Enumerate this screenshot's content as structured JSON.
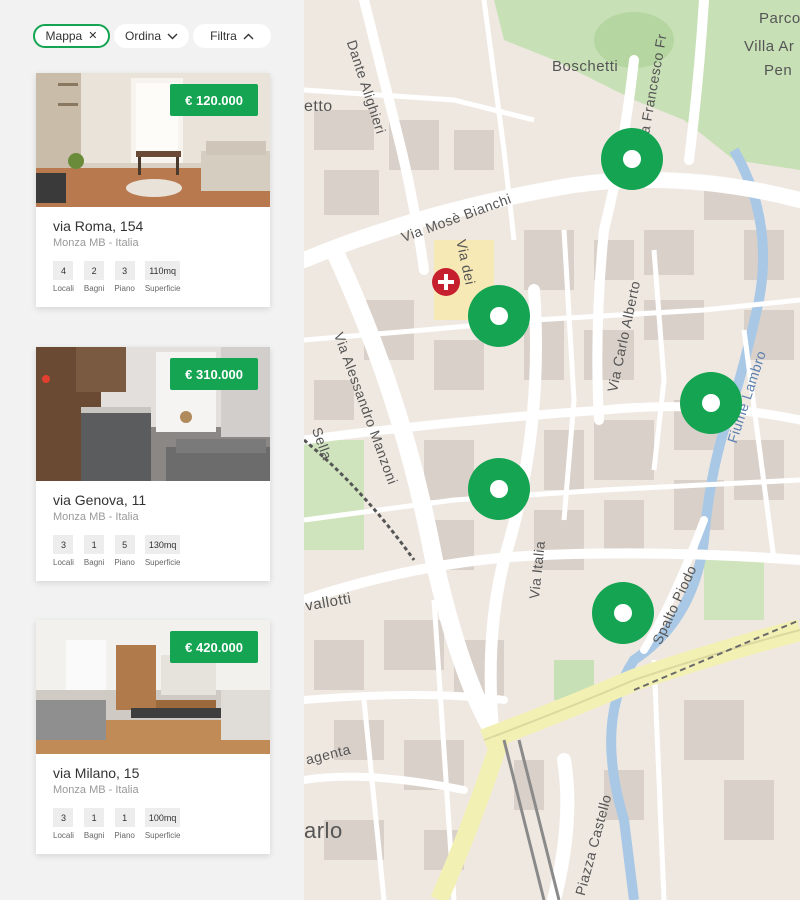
{
  "filters": {
    "map_label": "Mappa",
    "sort_label": "Ordina",
    "filter_label": "Filtra",
    "map_icon": "close-icon",
    "sort_icon": "chevron-down-icon",
    "filter_icon": "chevron-up-icon"
  },
  "stat_labels": {
    "rooms": "Locali",
    "baths": "Bagni",
    "floor": "Piano",
    "area": "Superficie"
  },
  "listings": [
    {
      "price": "€ 120.000",
      "address": "via Roma, 154",
      "city": "Monza MB - Italia",
      "rooms": "4",
      "baths": "2",
      "floor": "3",
      "area": "110mq"
    },
    {
      "price": "€ 310.000",
      "address": "via Genova, 11",
      "city": "Monza MB - Italia",
      "rooms": "3",
      "baths": "1",
      "floor": "5",
      "area": "130mq"
    },
    {
      "price": "€ 420.000",
      "address": "via Milano, 15",
      "city": "Monza MB - Italia",
      "rooms": "3",
      "baths": "1",
      "floor": "1",
      "area": "100mq"
    }
  ],
  "map": {
    "labels": {
      "dante": "Dante Alighieri",
      "boschetti": "Boschetti",
      "francesco": "Via Francesco Fr",
      "parco": "Parco",
      "villa": "Villa Ar",
      "pen": "Pen",
      "etto": "etto",
      "mose": "Via Mosè Bianchi",
      "dei": "Via dei",
      "carlo_alberto": "Via Carlo Alberto",
      "manzoni": "Via Alessandro Manzoni",
      "fiume": "Fiume Lambro",
      "sella": "Sella",
      "italia": "Via Italia",
      "vallotti": "vallotti",
      "spalto": "Spalto Piodo",
      "agenta": "agenta",
      "arlo": "arlo",
      "piazza": "Piazza Castello"
    }
  },
  "colors": {
    "accent": "#14a452",
    "hospital": "#c6202f"
  }
}
